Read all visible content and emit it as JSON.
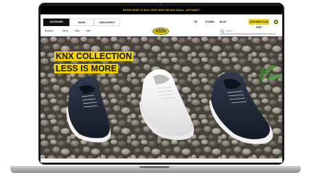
{
  "promo": {
    "text": "ENTER HERE TO BUY, DROP NEW PRIVATE EMAIL, OFF ENEXT"
  },
  "nav": {
    "tabs": [
      "OUTDOORS",
      "WORK",
      "KEEN EFFECT"
    ],
    "links": [
      "FR",
      "STORES",
      "BLOG"
    ],
    "join_label": "JOIN KEEN CLUB NOW",
    "account_icon": "account-icon"
  },
  "subnav": {
    "links": [
      "Womens",
      "Mens",
      "Kids",
      "Sale"
    ],
    "logo": "KEEN",
    "search_placeholder": "Search"
  },
  "hero": {
    "line1": "KNX COLLECTION",
    "line2": "LESS IS MORE"
  },
  "colors": {
    "brand_yellow": "#f1d200",
    "dark": "#111111",
    "device_bezel": "#1a1a1a"
  }
}
